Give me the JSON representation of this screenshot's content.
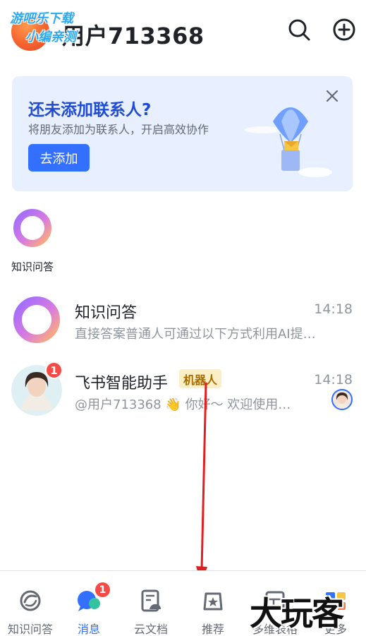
{
  "header": {
    "title": "用户713368",
    "watermark_line1": "游吧乐下载",
    "watermark_line2": "小编亲测"
  },
  "banner": {
    "title": "还未添加联系人?",
    "subtitle": "将朋友添加为联系人，开启高效协作",
    "button": "去添加"
  },
  "quick_item": {
    "label": "知识问答"
  },
  "chats": [
    {
      "name": "知识问答",
      "time": "14:18",
      "preview": "直接答案普通人可通过以下方式利用AI提…"
    },
    {
      "name": "飞书智能助手",
      "tag": "机器人",
      "badge": "1",
      "time": "14:18",
      "preview": "@用户713368 👋 你好～ 欢迎使用…"
    }
  ],
  "bottom_nav": [
    {
      "label": "知识问答",
      "icon": "knowledge-icon"
    },
    {
      "label": "消息",
      "icon": "message-icon",
      "badge": "1",
      "active": true
    },
    {
      "label": "云文档",
      "icon": "docs-icon"
    },
    {
      "label": "推荐",
      "icon": "recommend-icon"
    },
    {
      "label": "多维表格",
      "icon": "base-icon"
    },
    {
      "label": "更多",
      "icon": "more-icon"
    }
  ],
  "watermark_corner": "大玩客",
  "colors": {
    "accent": "#3370ff",
    "badge": "#f54a45",
    "banner_bg": "#e8effe",
    "tag_bg": "#fcefc6",
    "annotation_arrow": "#e02020"
  }
}
